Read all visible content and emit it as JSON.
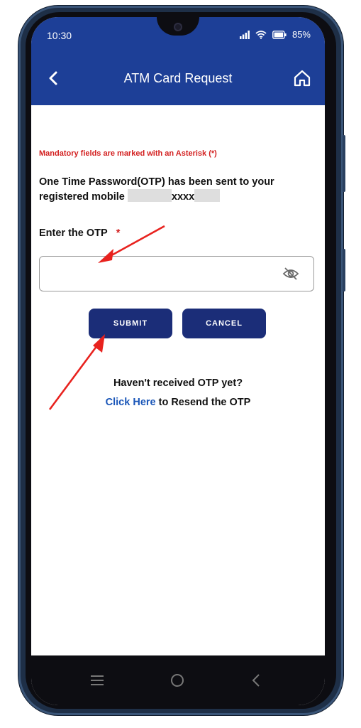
{
  "status_bar": {
    "time": "10:30",
    "battery": "85%"
  },
  "appbar": {
    "title": "ATM Card Request",
    "back_icon": "chevron-left-icon",
    "home_icon": "home-icon"
  },
  "form": {
    "mandatory_note": "Mandatory fields are marked with an Asterisk (*)",
    "otp_message_line1": "One Time Password(OTP) has been sent to your",
    "otp_message_line2": "registered mobile",
    "otp_message_masked": "xxxx",
    "otp_label": "Enter the OTP",
    "otp_required_marker": "*",
    "otp_value": "",
    "otp_placeholder": "",
    "visibility_icon": "eye-off-icon"
  },
  "buttons": {
    "submit_label": "SUBMIT",
    "cancel_label": "CANCEL"
  },
  "resend": {
    "question": "Haven't received OTP yet?",
    "link_label": "Click Here",
    "suffix": "to Resend the OTP"
  },
  "colors": {
    "header": "#1d3f97",
    "button": "#1b2d78",
    "required": "#d32020",
    "link": "#1a56b8",
    "annotation_arrow": "#e8221e"
  }
}
